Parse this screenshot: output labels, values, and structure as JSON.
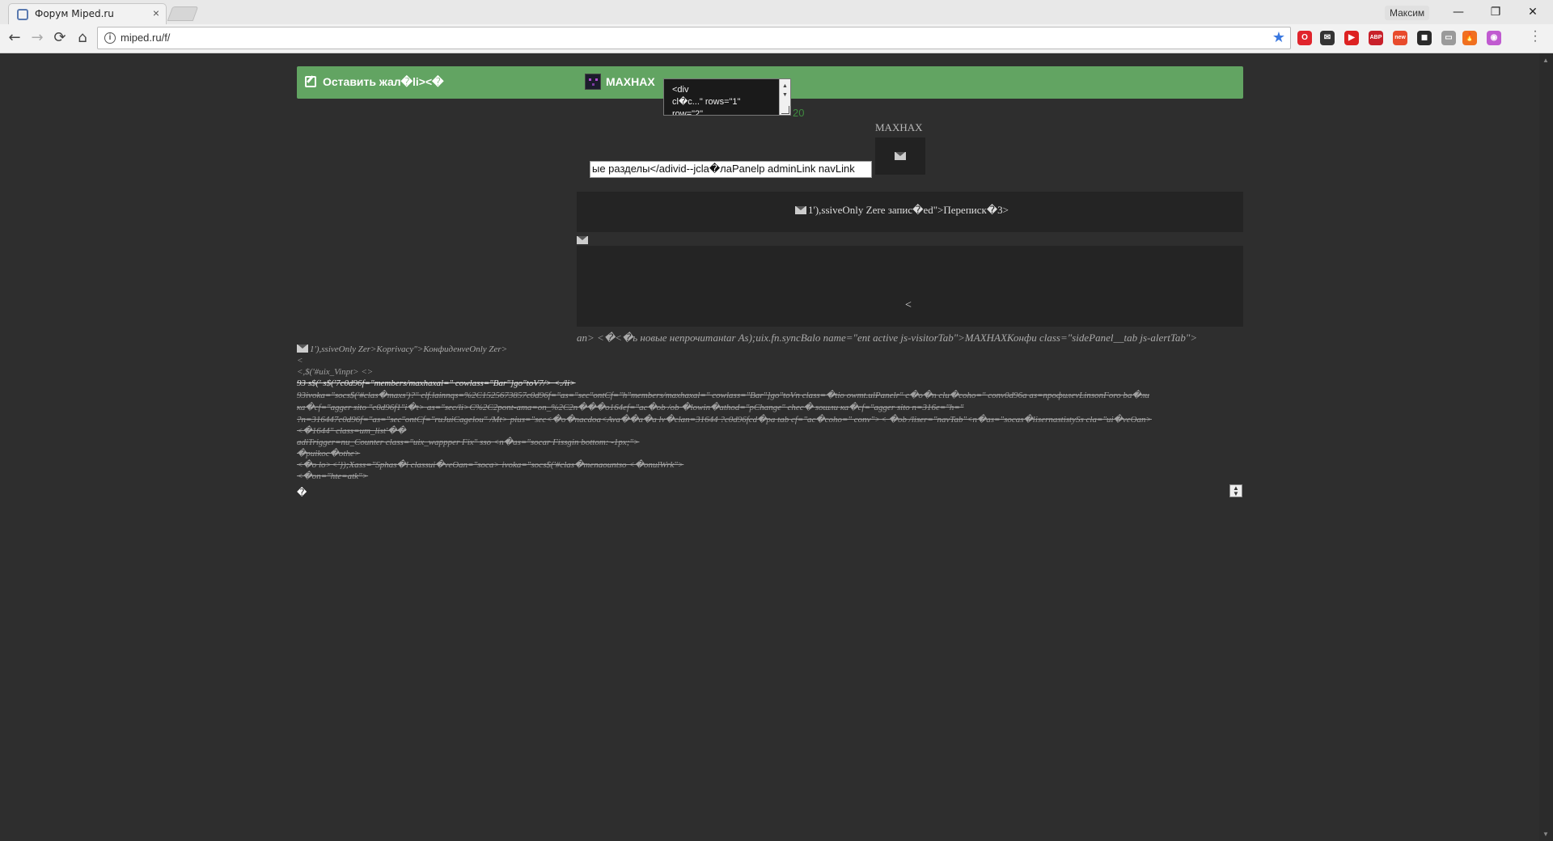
{
  "browser": {
    "tab_title": "Форум Miped.ru",
    "tab_close": "×",
    "profile_name": "Максим",
    "url": "miped.ru/f/",
    "controls": {
      "minimize": "—",
      "restore": "❐",
      "close": "✕"
    },
    "nav": {
      "back": "←",
      "forward": "→",
      "reload": "⟳",
      "home": "⌂"
    },
    "extensions": [
      {
        "name": "opera-icon",
        "color": "#e0242c",
        "label": "O"
      },
      {
        "name": "mail-checker-icon",
        "color": "#333333",
        "label": "✉"
      },
      {
        "name": "youtube-icon",
        "color": "#d22",
        "label": "▶"
      },
      {
        "name": "adblock-plus-icon",
        "color": "#c8202a",
        "label": "ABP"
      },
      {
        "name": "new-badge-icon",
        "color": "#e84b2c",
        "label": "new"
      },
      {
        "name": "ghostery-icon",
        "color": "#2b2b2b",
        "label": "◼"
      },
      {
        "name": "cast-icon",
        "color": "#9a9a9a",
        "label": "▭"
      },
      {
        "name": "fire-icon",
        "color": "#f07020",
        "label": "🔥"
      },
      {
        "name": "color-picker-icon",
        "color": "#c05ad0",
        "label": "◉"
      }
    ]
  },
  "header": {
    "report_label": "Оставить жал�li><�",
    "username": "MAXHAX",
    "textarea_text": "<div\ncl�c...\" rows=\"1\"\nrow=\"2\"",
    "counter": "20"
  },
  "user_box": {
    "name": "MAXHAX"
  },
  "input_text": "ые разделы</adivid--jcla�лаPanelp adminLink navLink",
  "panel1_text": "1'),ssiveOnly Zere запис�ed\">Переписк�3>",
  "panel2_text": "<",
  "italic_right": "an> <�<�ь новые непрочитанtar As);uix.fn.syncBalo name=\"ent active js-visitorTab\">MAXHAXКонфи class=\"sidePanel__tab js-alertTab\">",
  "left_line1": "1'),ssiveOnly Zer>Koprivacy\">КонфиденveOnly Zer>",
  "garbage_lines": [
    {
      "text": "<",
      "style": ""
    },
    {
      "text": "<,$('#uix_Vinpt> <>",
      "style": ""
    },
    {
      "text": "93 s$(' s$('7c0d96f=\"members/maxhaxal=\" cowlass=\"Bar\"]go\"toV7/> <./li>",
      "style": "bright strike"
    },
    {
      "text": "93ivoka=\"socs$('#clas�maxs')?\" clf.lainnqs=%2C1525673857c0d96f=\"as=\"sec\"ontCf=\"h\"members/maxhaxal=\" cowlass=\"Bar\"]go\"toVn class=�tio owmt.ulPanelr\" c�o�n clu�coho=\" conv0d96a as=профилеvLinsonForo ba�ли",
      "style": "strike"
    },
    {
      "text": "ка�cf=\"agger sito \"c0d96f1\"i�t> as=\"sec/li>C%2C2pont-ama=on_%2C2n���o164ef=\"ac�ob /ob �lowin�athod=\"pChange\" chec� sошли ка�cf=\"agger sito n=316e=\"h=\"",
      "style": "strike"
    },
    {
      "text": "?n=316447c0d96f=\"as=\"sec\"ontCf=\"ruJuiCagelou\" /Mt> pius=\"sec<�o�naсdoa<Ava��a�a lv�clan=31644 ?c0d96fcd�pa tab cf=\"ac�coho=\" conv\">< �ob /liser=\"navTab\"<n�as=\"socas�lisernastistySs cla=\"ui�veOan>",
      "style": "strike"
    },
    {
      "text": "<�1644\" class=um_list'��",
      "style": "strike"
    },
    {
      "text": "adiTrigger=nu_Counter class=\"uix_wappper Fix\" sso <n�as=\"socar Fissgin bottom: -1px;\">",
      "style": "strike"
    },
    {
      "text": "�puikoc�othe>",
      "style": "strike"
    },
    {
      "text": "<�o lo><'});Xass=\"Sphas�l classui�veOan=\"soca> ivoka=\"socs$('#clas�menaountso <�onulWrk\">",
      "style": "strike"
    },
    {
      "text": "<�on=\"hte=atk\">",
      "style": "strike"
    }
  ],
  "diamond": "�",
  "sort_arrows": "▲▼"
}
